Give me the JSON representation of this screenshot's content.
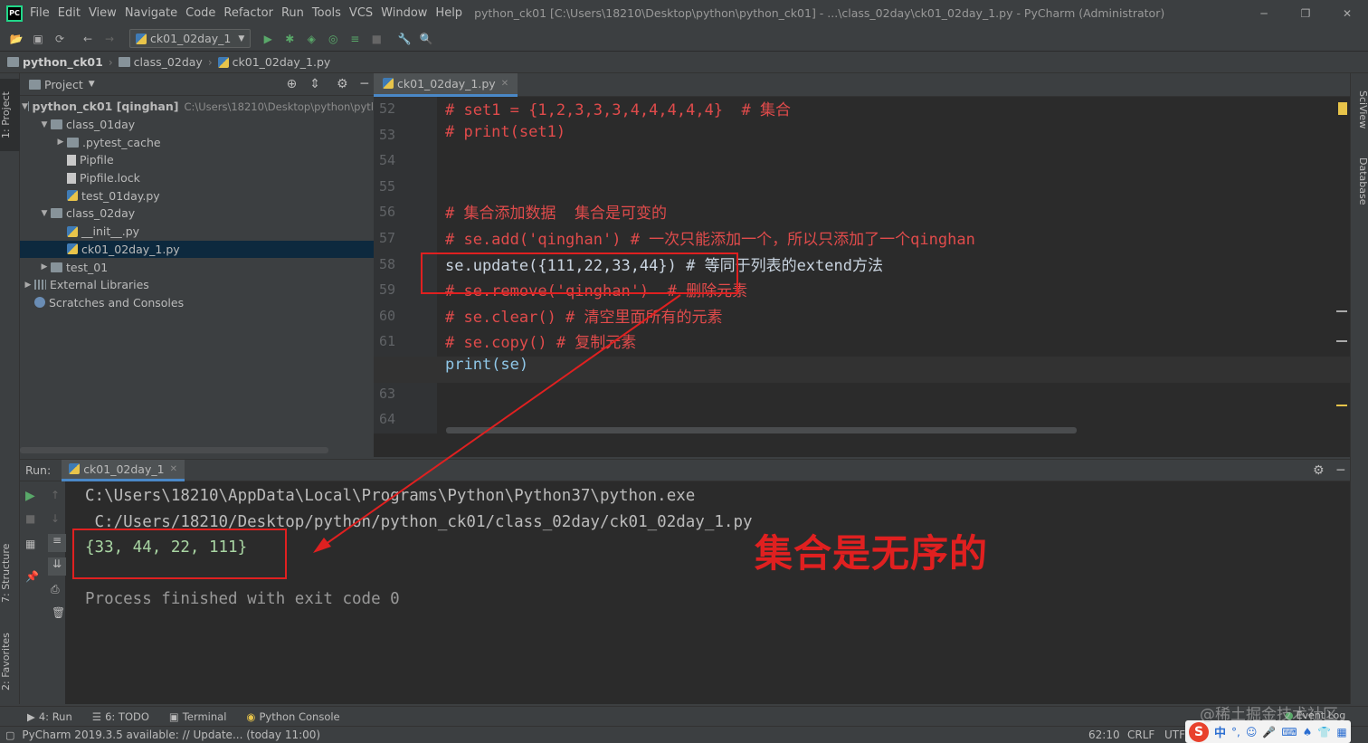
{
  "titlebar": {
    "menu": [
      "File",
      "Edit",
      "View",
      "Navigate",
      "Code",
      "Refactor",
      "Run",
      "Tools",
      "VCS",
      "Window",
      "Help"
    ],
    "title": "python_ck01 [C:\\Users\\18210\\Desktop\\python\\python_ck01] - ...\\class_02day\\ck01_02day_1.py - PyCharm (Administrator)"
  },
  "toolbar": {
    "run_config": "ck01_02day_1"
  },
  "breadcrumb": [
    "python_ck01",
    "class_02day",
    "ck01_02day_1.py"
  ],
  "project_panel": {
    "title": "Project",
    "tree": [
      {
        "label": "python_ck01 [qinghan]",
        "path": "C:\\Users\\18210\\Desktop\\python\\pytl",
        "icon": "folder-icon",
        "depth": 0,
        "expanded": true
      },
      {
        "label": "class_01day",
        "icon": "folder-icon",
        "depth": 1,
        "expanded": true
      },
      {
        "label": ".pytest_cache",
        "icon": "folder-icon",
        "depth": 2,
        "expanded": false
      },
      {
        "label": "Pipfile",
        "icon": "file-icon",
        "depth": 2
      },
      {
        "label": "Pipfile.lock",
        "icon": "file-icon",
        "depth": 2
      },
      {
        "label": "test_01day.py",
        "icon": "python-file-icon",
        "depth": 2
      },
      {
        "label": "class_02day",
        "icon": "folder-icon",
        "depth": 1,
        "expanded": true
      },
      {
        "label": "__init__.py",
        "icon": "python-file-icon",
        "depth": 2
      },
      {
        "label": "ck01_02day_1.py",
        "icon": "python-file-icon",
        "depth": 2,
        "selected": true
      },
      {
        "label": "test_01",
        "icon": "folder-icon",
        "depth": 1,
        "expanded": false
      },
      {
        "label": "External Libraries",
        "icon": "library-icon",
        "depth": 0,
        "expanded": false
      },
      {
        "label": "Scratches and Consoles",
        "icon": "scratches-icon",
        "depth": 0
      }
    ]
  },
  "editor": {
    "tab": "ck01_02day_1.py",
    "lines": [
      {
        "n": "52",
        "text": "# set1 = {1,2,3,3,3,4,4,4,4,4}  # 集合",
        "kind": "comment"
      },
      {
        "n": "53",
        "text": "# print(set1)",
        "kind": "comment"
      },
      {
        "n": "54",
        "text": "",
        "kind": "code"
      },
      {
        "n": "55",
        "text": "",
        "kind": "code"
      },
      {
        "n": "56",
        "text": "# 集合添加数据  集合是可变的",
        "kind": "comment"
      },
      {
        "n": "57",
        "text": "# se.add('qinghan') # 一次只能添加一个，所以只添加了一个qinghan",
        "kind": "comment"
      },
      {
        "n": "58",
        "text": "se.update({111,22,33,44}) # 等同于列表的extend方法",
        "kind": "mixed"
      },
      {
        "n": "59",
        "text": "# se.remove('qinghan')  # 删除元素",
        "kind": "comment"
      },
      {
        "n": "60",
        "text": "# se.clear() # 清空里面所有的元素",
        "kind": "comment"
      },
      {
        "n": "61",
        "text": "# se.copy() # 复制元素",
        "kind": "comment"
      },
      {
        "n": "62",
        "text": "print(se)",
        "kind": "print"
      },
      {
        "n": "63",
        "text": "",
        "kind": "code"
      },
      {
        "n": "64",
        "text": "",
        "kind": "code"
      }
    ]
  },
  "run_panel": {
    "label": "Run:",
    "tab": "ck01_02day_1",
    "output": [
      "C:\\Users\\18210\\AppData\\Local\\Programs\\Python\\Python37\\python.exe",
      " C:/Users/18210/Desktop/python/python_ck01/class_02day/ck01_02day_1.py",
      "{33, 44, 22, 111}",
      "",
      "Process finished with exit code 0"
    ]
  },
  "annotation": {
    "text": "集合是无序的",
    "color": "#e02020"
  },
  "bottom_tabs": [
    "4: Run",
    "6: TODO",
    "Terminal",
    "Python Console"
  ],
  "side_tabs": {
    "left": [
      "1: Project",
      "7: Structure",
      "2: Favorites"
    ],
    "right": [
      "SciView",
      "Database"
    ]
  },
  "statusbar": {
    "message": "PyCharm 2019.3.5 available: // Update... (today 11:00)",
    "position": "62:10",
    "line_sep": "CRLF",
    "encoding": "UTF-",
    "event_log": "Event Log"
  },
  "watermark": "@稀土掘金技术社区"
}
